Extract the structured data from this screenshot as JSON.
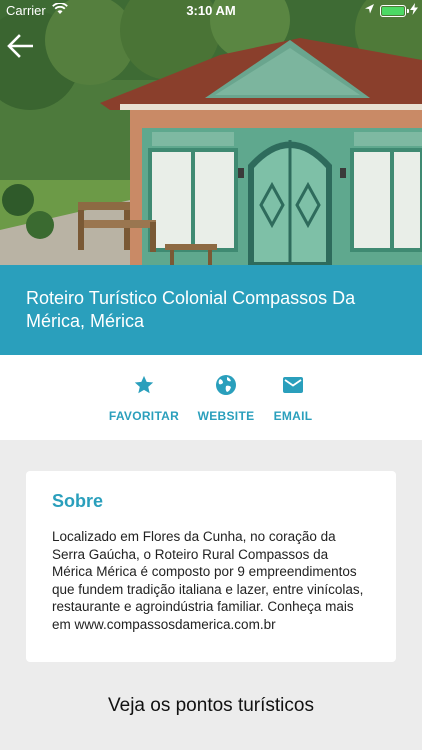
{
  "status_bar": {
    "carrier": "Carrier",
    "time": "3:10 AM",
    "battery_color": "#4cd964"
  },
  "header": {
    "back_icon": "arrow-left-icon",
    "title": "Roteiro Turístico Colonial Compassos Da Mérica, Mérica"
  },
  "actions": [
    {
      "label": "FAVORITAR",
      "icon": "star-icon"
    },
    {
      "label": "WEBSITE",
      "icon": "globe-icon"
    },
    {
      "label": "EMAIL",
      "icon": "mail-icon"
    }
  ],
  "about": {
    "title": "Sobre",
    "body": "Localizado em Flores da Cunha, no coração da Serra Gaúcha, o Roteiro Rural Compassos da Mérica Mérica é composto por 9 empreendimentos que fundem tradição italiana e lazer, entre vinícolas, restaurante e agroindústria familiar. Conheça mais em www.compassosdamerica.com.br"
  },
  "points_section": {
    "title": "Veja os pontos turísticos"
  },
  "colors": {
    "accent": "#2a9fbc",
    "background": "#ececec"
  }
}
